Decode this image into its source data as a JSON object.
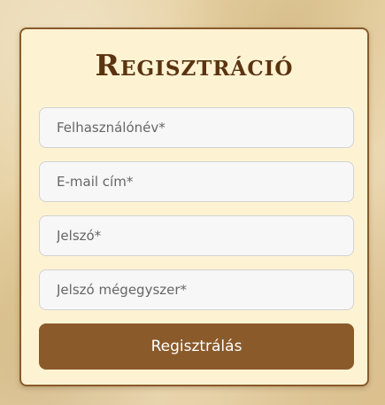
{
  "form": {
    "title": "Regisztráció",
    "fields": [
      {
        "placeholder": "Felhasználónév*",
        "value": ""
      },
      {
        "placeholder": "E-mail cím*",
        "value": ""
      },
      {
        "placeholder": "Jelszó*",
        "value": ""
      },
      {
        "placeholder": "Jelszó mégegyszer*",
        "value": ""
      }
    ],
    "submit_label": "Regisztrálás"
  },
  "colors": {
    "accent": "#8b5a2b",
    "title": "#5b3310",
    "card_background": "#fdf3d3"
  }
}
